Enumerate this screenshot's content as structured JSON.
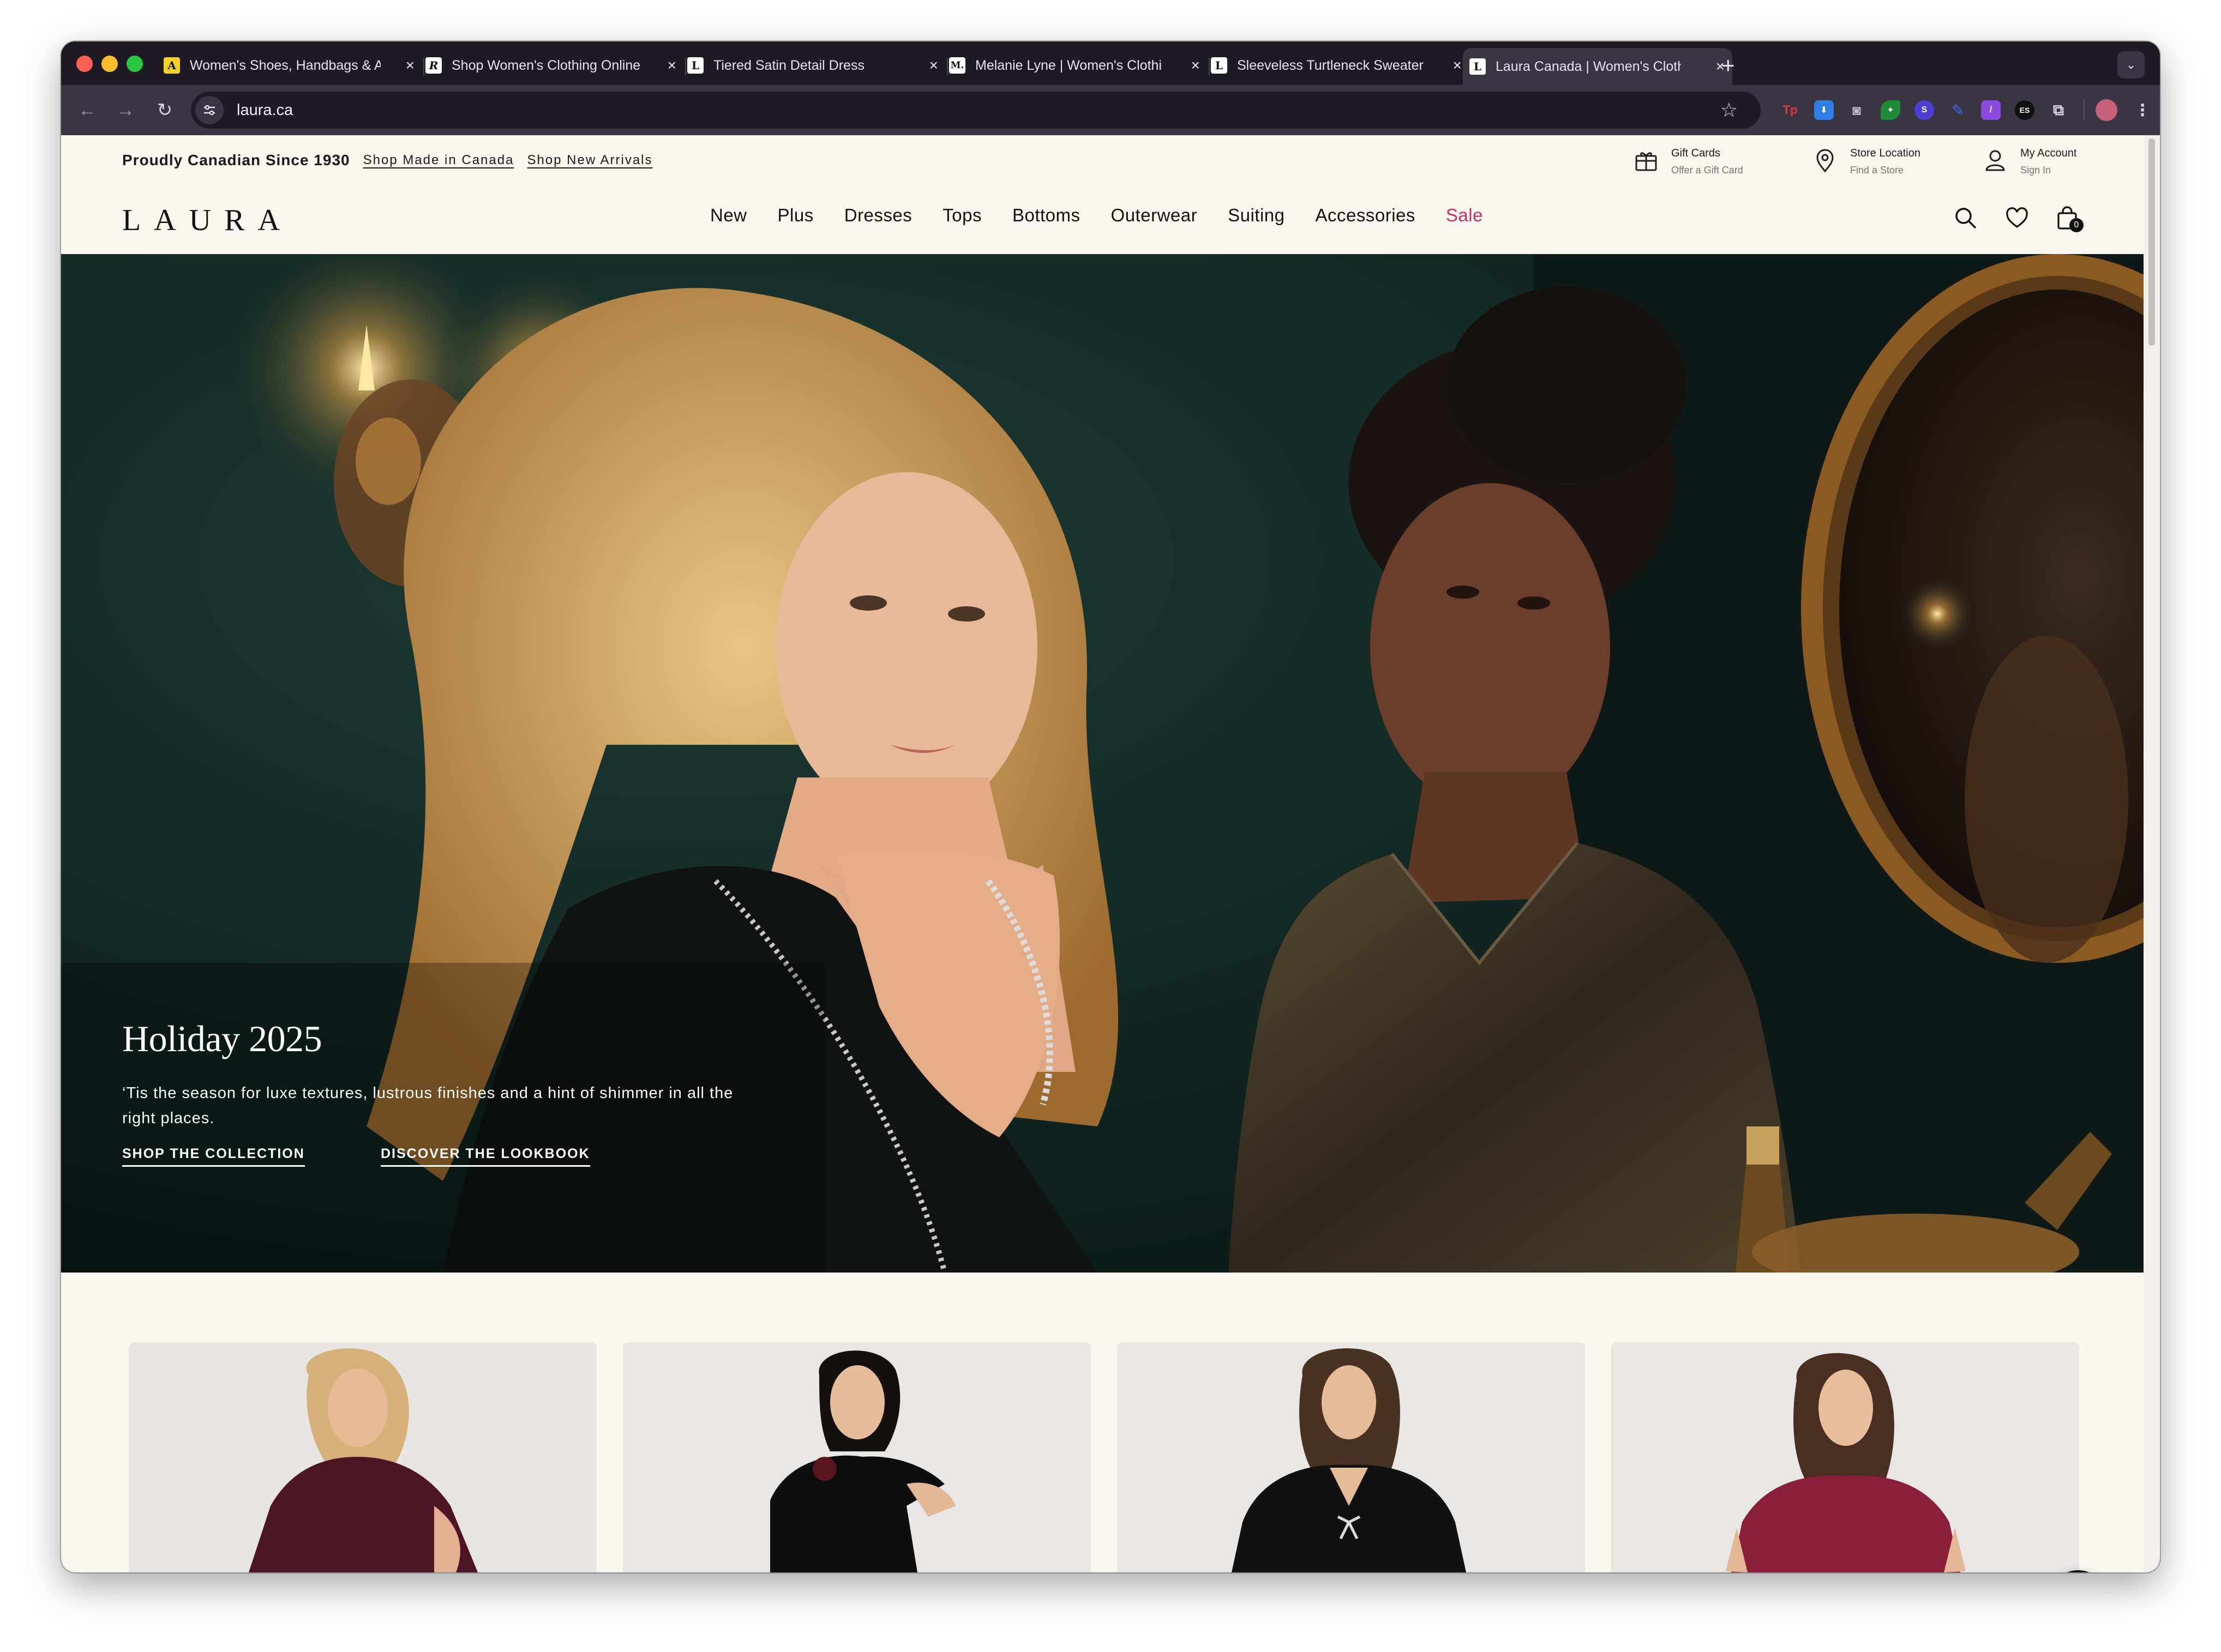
{
  "browser": {
    "tabs": [
      {
        "title": "Women's Shoes, Handbags & A",
        "favicon": "a-icon",
        "favicon_color": "#f5d226",
        "active": false
      },
      {
        "title": "Shop Women's Clothing Online",
        "favicon": "r-icon",
        "favicon_color": "#111111",
        "active": false
      },
      {
        "title": "Tiered Satin Detail Dress",
        "favicon": "l-icon",
        "favicon_color": "#ffffff",
        "active": false
      },
      {
        "title": "Melanie Lyne | Women's Clothi",
        "favicon": "ml-icon",
        "favicon_color": "#111111",
        "active": false
      },
      {
        "title": "Sleeveless Turtleneck Sweater",
        "favicon": "l-icon",
        "favicon_color": "#ffffff",
        "active": false
      },
      {
        "title": "Laura Canada | Women's Cloth",
        "favicon": "l-icon",
        "favicon_color": "#ffffff",
        "active": true
      }
    ],
    "url": "laura.ca",
    "extensions": [
      "Tp",
      "ES"
    ]
  },
  "site": {
    "promo": {
      "lead": "Proudly Canadian Since 1930",
      "links": [
        "Shop Made in Canada",
        "Shop New Arrivals"
      ]
    },
    "utility": [
      {
        "title": "Gift Cards",
        "sub": "Offer a Gift Card",
        "icon": "gift-icon"
      },
      {
        "title": "Store Location",
        "sub": "Find a Store",
        "icon": "location-pin-icon"
      },
      {
        "title": "My Account",
        "sub": "Sign In",
        "icon": "user-icon"
      }
    ],
    "logo": "LAURA",
    "nav": [
      "New",
      "Plus",
      "Dresses",
      "Tops",
      "Bottoms",
      "Outerwear",
      "Suiting",
      "Accessories",
      "Sale"
    ],
    "sale_color": "#c8325a",
    "bag_count": "0"
  },
  "hero": {
    "title": "Holiday 2025",
    "copy": "‘Tis the season for luxe textures, lustrous finishes and a hint of shimmer in all the right places.",
    "cta_primary": "SHOP THE COLLECTION",
    "cta_secondary": "DISCOVER THE LOOKBOOK"
  },
  "products": [
    {
      "alt": "Model in burgundy satin blouse"
    },
    {
      "alt": "Model in black one-shoulder top"
    },
    {
      "alt": "Model in black V-neck sweater with bow"
    },
    {
      "alt": "Model in raspberry short-sleeve sweater"
    }
  ],
  "colors": {
    "accent": "#c8325a",
    "page_bg": "#faf6f0",
    "chrome": "#1f1b25"
  }
}
